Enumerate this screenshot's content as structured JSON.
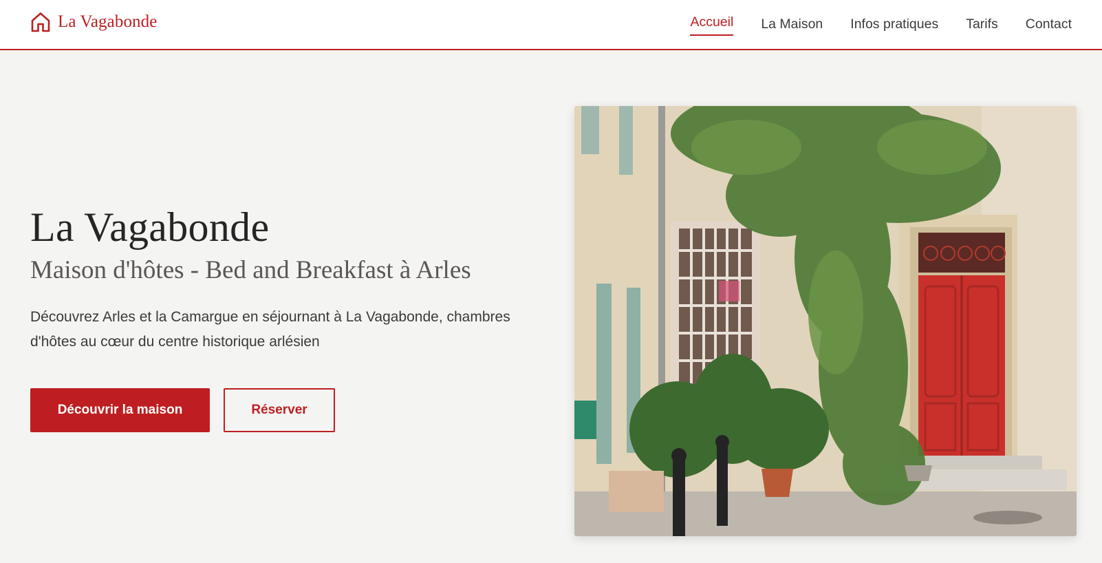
{
  "brand": {
    "name": "La Vagabonde",
    "icon": "home-icon",
    "color": "#be1e22"
  },
  "nav": {
    "items": [
      {
        "label": "Accueil",
        "active": true
      },
      {
        "label": "La Maison",
        "active": false
      },
      {
        "label": "Infos pratiques",
        "active": false
      },
      {
        "label": "Tarifs",
        "active": false
      },
      {
        "label": "Contact",
        "active": false
      }
    ]
  },
  "hero": {
    "title": "La Vagabonde",
    "subtitle": "Maison d'hôtes - Bed and Breakfast à Arles",
    "description": "Découvrez Arles et la Camargue en séjournant à La Vagabonde, chambres d'hôtes au cœur du centre historique arlésien",
    "primary_button": "Découvrir la maison",
    "secondary_button": "Réserver",
    "image_icon": "house-facade-photo"
  },
  "colors": {
    "accent": "#be1e22",
    "background": "#f4f4f2",
    "text": "#2b2b2b"
  }
}
